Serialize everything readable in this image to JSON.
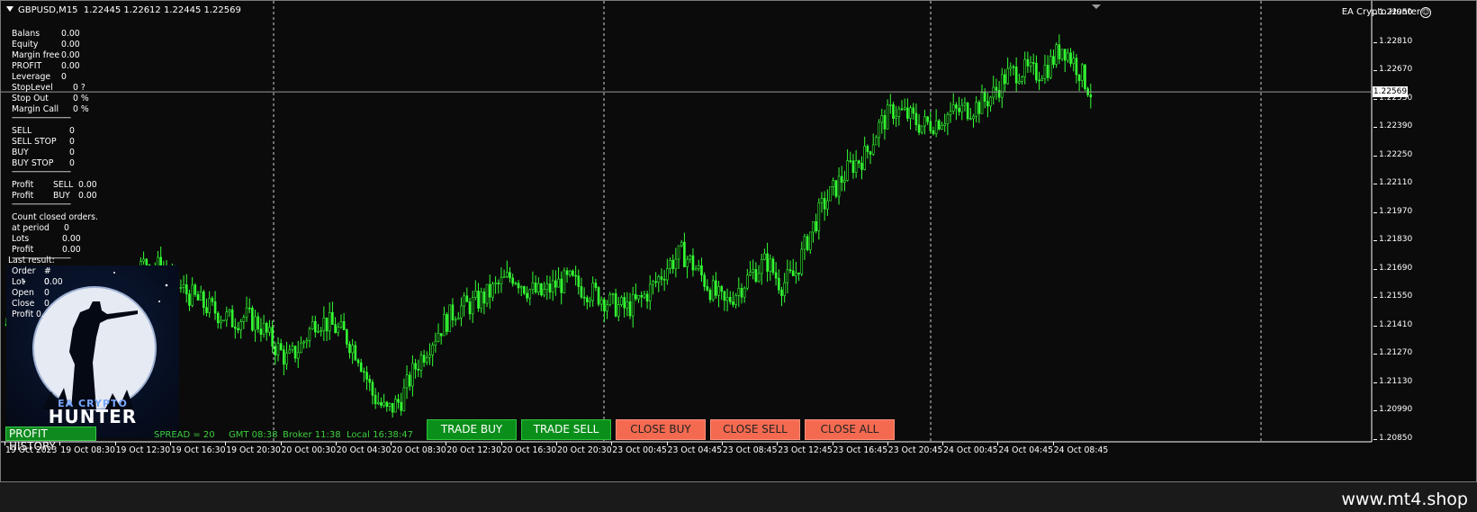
{
  "header": {
    "symbol_line": "GBPUSD,M15  1.22445 1.22612 1.22445 1.22569",
    "ea_name": "EA Crypto Hunter"
  },
  "account": [
    {
      "label": "Balans",
      "value": "0.00"
    },
    {
      "label": "Equity",
      "value": "0.00"
    },
    {
      "label": "Margin free",
      "value": "0.00"
    },
    {
      "label": "PROFIT",
      "value": "0.00"
    },
    {
      "label": "Leverage",
      "value": "0"
    },
    {
      "label": "StopLevel",
      "value": "0 ?"
    },
    {
      "label": "Stop Out",
      "value": "0 %"
    },
    {
      "label": "Margin Call",
      "value": "0 %"
    }
  ],
  "orders": [
    {
      "label": "SELL",
      "value": "0"
    },
    {
      "label": "SELL STOP",
      "value": "0"
    },
    {
      "label": "BUY",
      "value": "0"
    },
    {
      "label": "BUY STOP",
      "value": "0"
    }
  ],
  "profit_rows": [
    {
      "label": "Profit",
      "side": "SELL",
      "value": "0.00"
    },
    {
      "label": "Profit",
      "side": "BUY",
      "value": "0.00"
    }
  ],
  "closed": {
    "title": "Count closed orders.",
    "rows": [
      {
        "label": "at period",
        "value": "0"
      },
      {
        "label": "Lots",
        "value": "0.00"
      },
      {
        "label": "Profit",
        "value": "0.00"
      }
    ]
  },
  "last_result": {
    "title": "Last result:",
    "rows": [
      {
        "label": "Order",
        "value": "# 0"
      },
      {
        "label": "Lot",
        "value": "0.00"
      },
      {
        "label": "Open",
        "value": "0"
      },
      {
        "label": "Close",
        "value": "0"
      },
      {
        "label": "Profit",
        "value": "0."
      }
    ]
  },
  "separator": "-----------------------------",
  "logo": {
    "top": "EA CRYPTO",
    "main": "HUNTER"
  },
  "bottom_bar": {
    "profit_history": "PROFIT HISTORY",
    "spread": "SPREAD = 20",
    "gmt": "GMT 08:38",
    "broker": "Broker 11:38",
    "local": "Local 16:38:47"
  },
  "buttons": {
    "trade_buy": "TRADE BUY",
    "trade_sell": "TRADE SELL",
    "close_buy": "CLOSE BUY",
    "close_sell": "CLOSE SELL",
    "close_all": "CLOSE ALL"
  },
  "current_price": "1.22569",
  "watermark": "www.mt4.shop",
  "colors": {
    "candle": "#33ff33",
    "buy_btn": "#0b8f1b",
    "close_btn": "#f46a50",
    "background": "#0b0b0b"
  },
  "chart_data": {
    "type": "line",
    "ytick_labels": [
      "1.22950",
      "1.22810",
      "1.22670",
      "1.22530",
      "1.22390",
      "1.22250",
      "1.22110",
      "1.21970",
      "1.21830",
      "1.21690",
      "1.21550",
      "1.21410",
      "1.21270",
      "1.21130",
      "1.20990",
      "1.20850"
    ],
    "xtick_labels": [
      "19 Oct 2023",
      "19 Oct 08:30",
      "19 Oct 12:30",
      "19 Oct 16:30",
      "19 Oct 20:30",
      "20 Oct 00:30",
      "20 Oct 04:30",
      "20 Oct 08:30",
      "20 Oct 12:30",
      "20 Oct 16:30",
      "20 Oct 20:30",
      "23 Oct 00:45",
      "23 Oct 04:45",
      "23 Oct 08:45",
      "23 Oct 12:45",
      "23 Oct 16:45",
      "23 Oct 20:45",
      "24 Oct 00:45",
      "24 Oct 04:45",
      "24 Oct 08:45"
    ],
    "ylim": [
      1.2082,
      1.2299
    ],
    "current_price": 1.22569,
    "close_path": [
      1.214,
      1.2138,
      1.2132,
      1.2128,
      1.212,
      1.2112,
      1.2108,
      1.2135,
      1.215,
      1.2165,
      1.2172,
      1.2168,
      1.216,
      1.2155,
      1.215,
      1.2146,
      1.2142,
      1.2144,
      1.214,
      1.213,
      1.2122,
      1.213,
      1.2143,
      1.214,
      1.2135,
      1.2125,
      1.2105,
      1.2096,
      1.2102,
      1.2118,
      1.213,
      1.214,
      1.2148,
      1.215,
      1.2154,
      1.216,
      1.2165,
      1.2158,
      1.2155,
      1.216,
      1.2162,
      1.2158,
      1.2155,
      1.215,
      1.2148,
      1.2152,
      1.216,
      1.217,
      1.2176,
      1.2168,
      1.2158,
      1.215,
      1.2158,
      1.2166,
      1.2172,
      1.216,
      1.2165,
      1.2185,
      1.22,
      1.221,
      1.222,
      1.2225,
      1.224,
      1.2248,
      1.2245,
      1.224,
      1.2242,
      1.2246,
      1.2248,
      1.225,
      1.2255,
      1.2265,
      1.2268,
      1.2266,
      1.227,
      1.228,
      1.227,
      1.2257
    ]
  }
}
